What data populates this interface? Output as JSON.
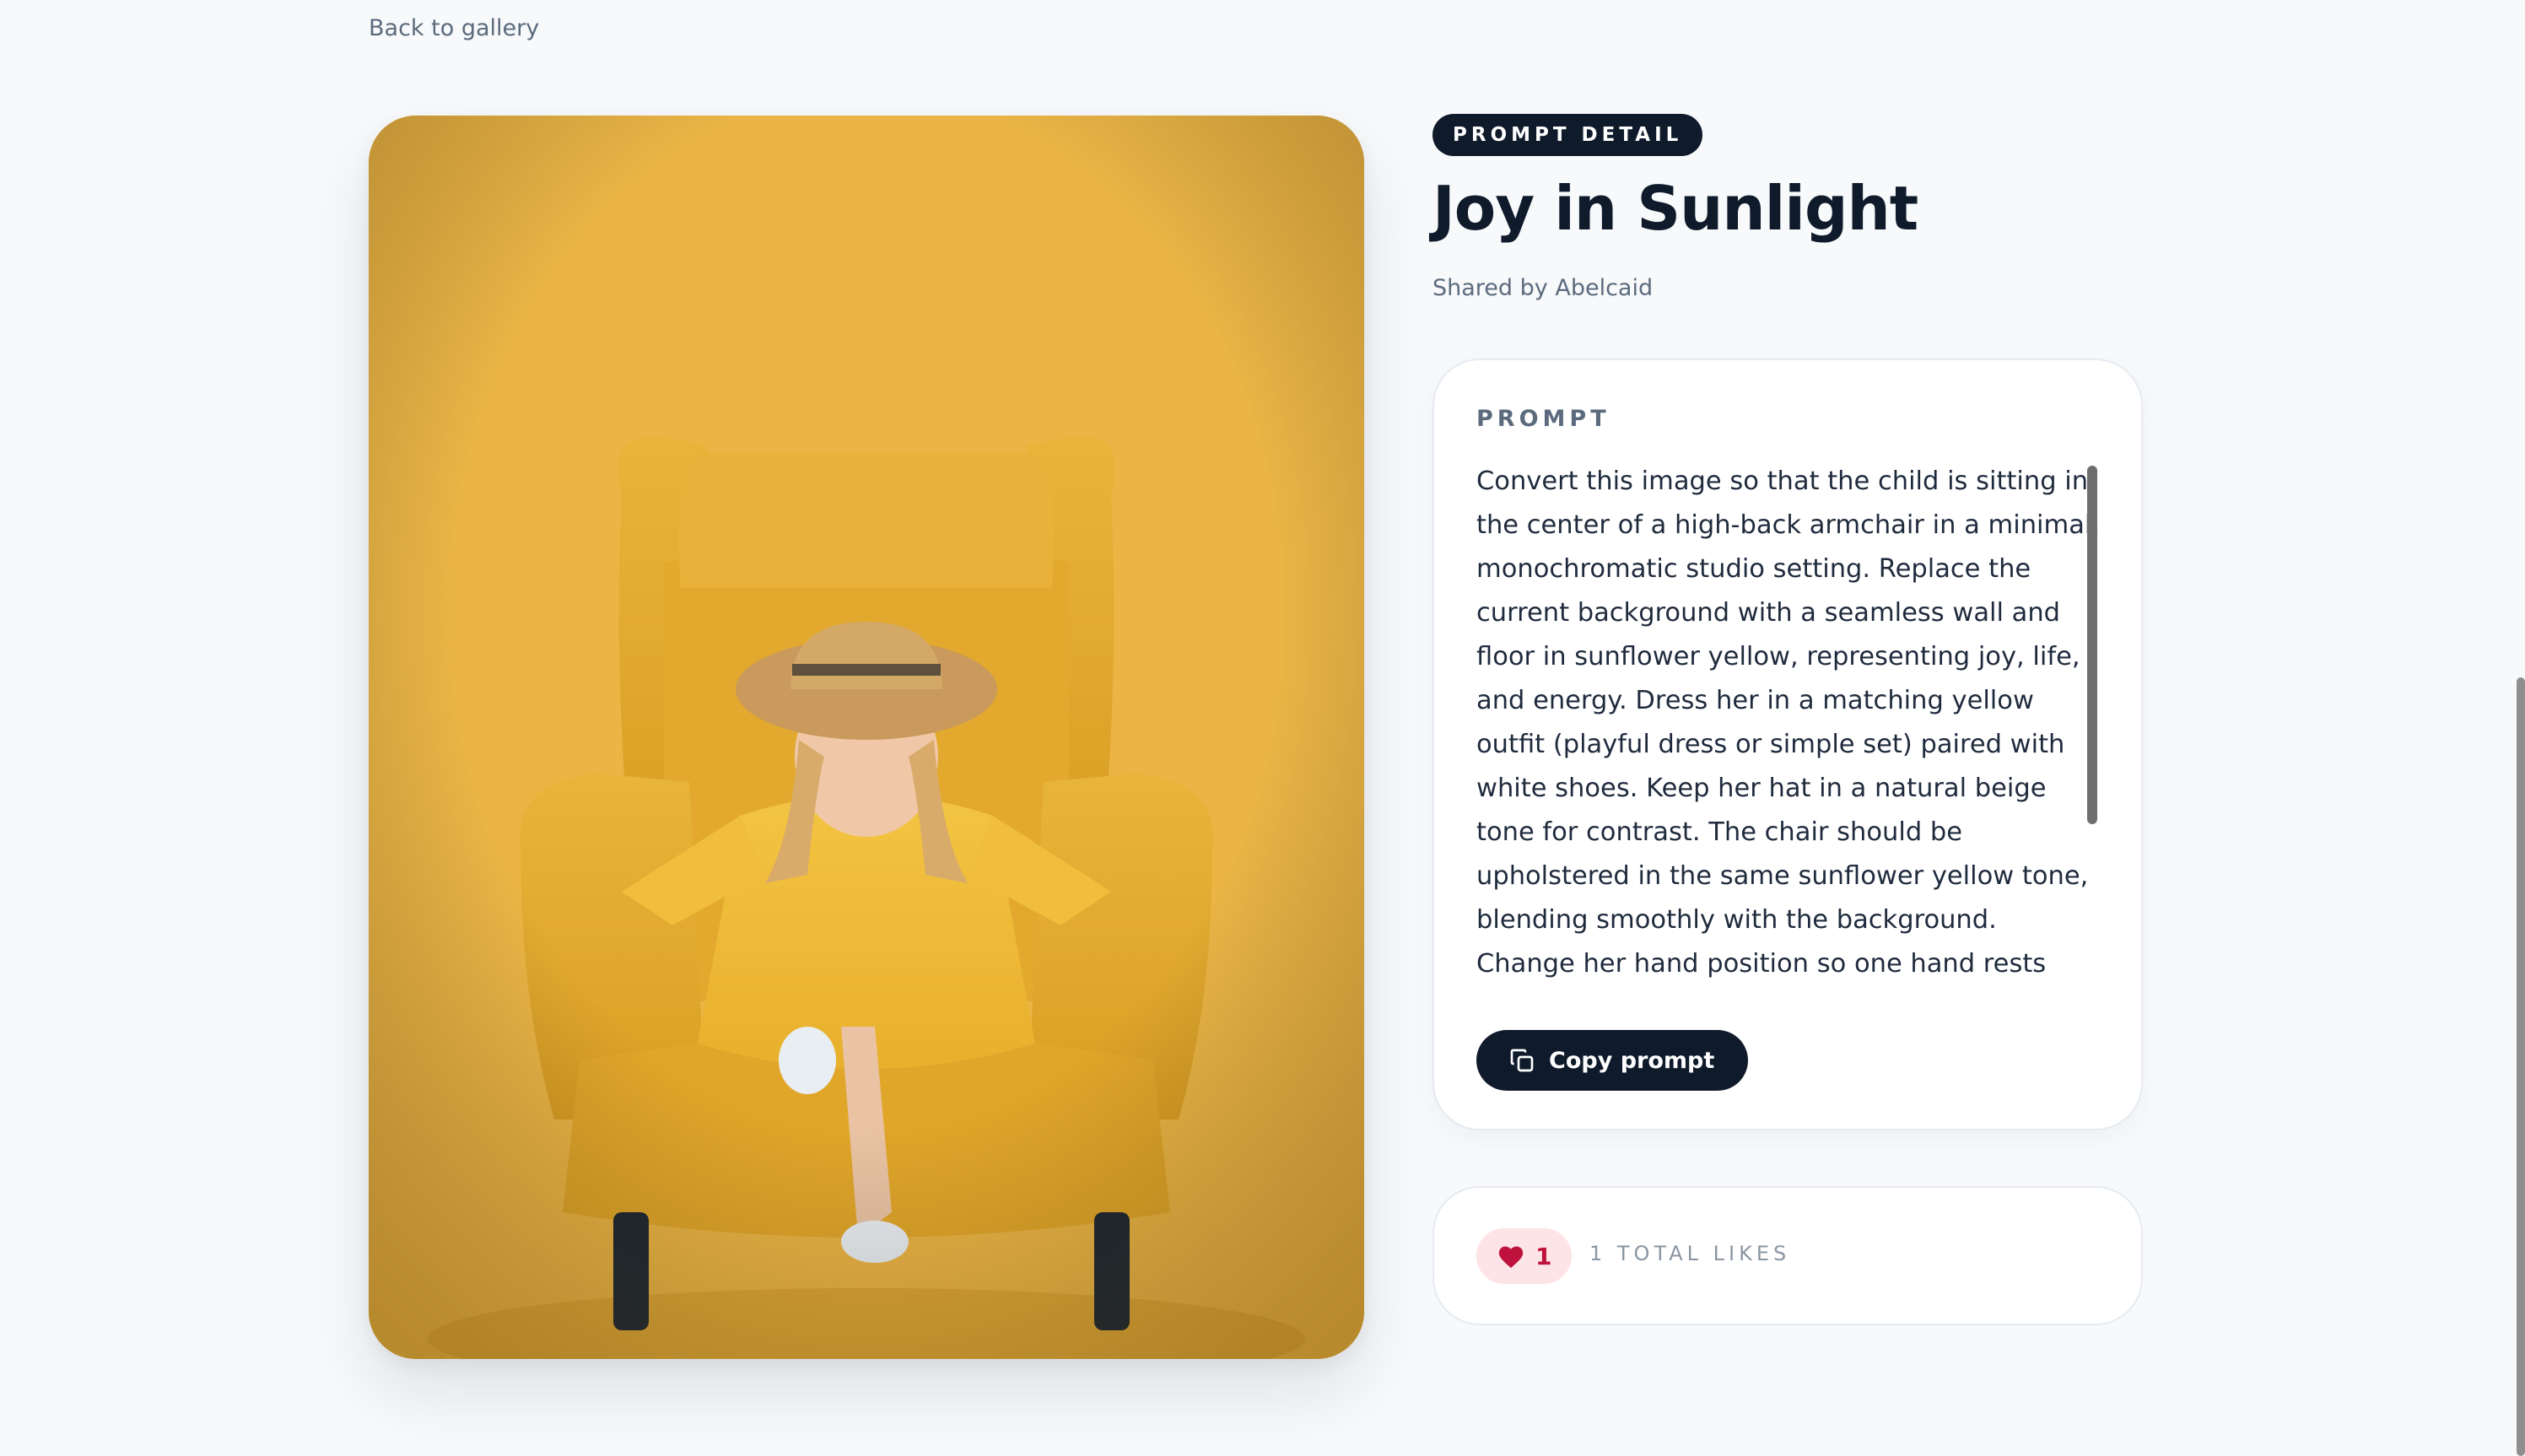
{
  "nav": {
    "back_label": "Back to gallery"
  },
  "hero": {
    "icon": "child-in-armchair-photo"
  },
  "detail": {
    "badge": "PROMPT DETAIL",
    "title": "Joy in Sunlight",
    "shared_prefix": "Shared by ",
    "author": "Abelcaid"
  },
  "prompt": {
    "label": "PROMPT",
    "text": "Convert this image so that the child is sitting in the center of a high-back armchair in a minimal, monochromatic studio setting. Replace the current background with a seamless wall and floor in sunflower yellow, representing joy, life, and energy. Dress her in a matching yellow outfit (playful dress or simple set) paired with white shoes. Keep her hat in a natural beige tone for contrast. The chair should be upholstered in the same sunflower yellow tone, blending smoothly with the background. Change her hand position so one hand rests lightly on the armrest while the other rests in her lap, giving a playful, cheerful pose.",
    "copy_label": "Copy prompt",
    "copy_icon": "copy-icon"
  },
  "likes": {
    "count": "1",
    "total_label": "1 TOTAL LIKES",
    "icon": "heart-icon"
  },
  "colors": {
    "primary": "#0f1a2b",
    "background": "#f7f9fb",
    "like_bg": "#fde4e7",
    "like_fg": "#be123c",
    "sunflower": "#ecb64b"
  }
}
